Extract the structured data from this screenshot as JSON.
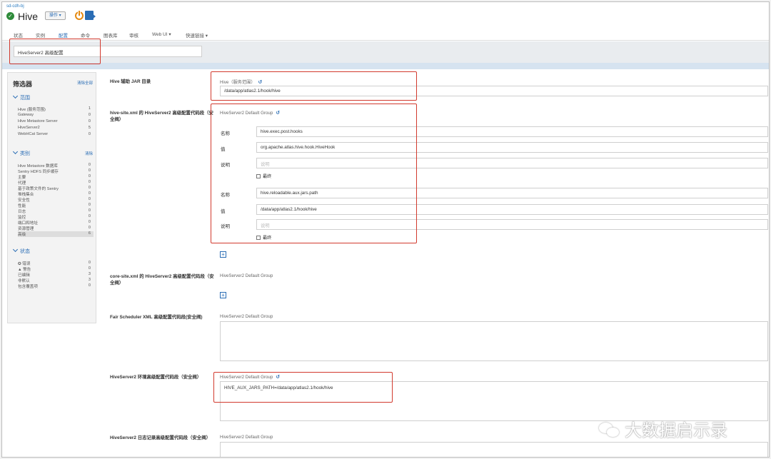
{
  "header": {
    "cluster": "sd-cdh-bj",
    "service_title": "Hive",
    "actions_label": "操作 ▾"
  },
  "tabs": [
    {
      "label": "状态"
    },
    {
      "label": "实例"
    },
    {
      "label": "配置"
    },
    {
      "label": "命令"
    },
    {
      "label": "图表库"
    },
    {
      "label": "审核"
    },
    {
      "label": "Web UI ▾"
    },
    {
      "label": "快速链接 ▾"
    }
  ],
  "active_tab": "配置",
  "search": {
    "value": "HiveServer2 高级配置"
  },
  "sidebar": {
    "title": "筛选器",
    "clear_all": "清除全部",
    "scope": {
      "heading": "范围",
      "items": [
        {
          "label": "Hive (服务范围)",
          "count": "1"
        },
        {
          "label": "Gateway",
          "count": "0"
        },
        {
          "label": "Hive Metastore Server",
          "count": "0"
        },
        {
          "label": "HiveServer2",
          "count": "5"
        },
        {
          "label": "WebHCat Server",
          "count": "0"
        }
      ]
    },
    "category": {
      "heading": "类别",
      "clear": "清除",
      "items": [
        {
          "label": "Hive Metastore 数据库",
          "count": "0"
        },
        {
          "label": "Sentry HDFS 同步缓存",
          "count": "0"
        },
        {
          "label": "主要",
          "count": "0"
        },
        {
          "label": "代理",
          "count": "0"
        },
        {
          "label": "基于政策文件的 Sentry",
          "count": "0"
        },
        {
          "label": "堆栈集合",
          "count": "0"
        },
        {
          "label": "安全性",
          "count": "0"
        },
        {
          "label": "性能",
          "count": "0"
        },
        {
          "label": "日志",
          "count": "0"
        },
        {
          "label": "监控",
          "count": "0"
        },
        {
          "label": "端口和地址",
          "count": "0"
        },
        {
          "label": "资源管理",
          "count": "0"
        },
        {
          "label": "高级",
          "count": "6"
        }
      ]
    },
    "status": {
      "heading": "状态",
      "items": [
        {
          "label": "✪ 错误",
          "count": "0"
        },
        {
          "label": "▲ 警告",
          "count": "0"
        },
        {
          "label": "已编辑",
          "count": "3"
        },
        {
          "label": "非默认",
          "count": "3"
        },
        {
          "label": "包含覆盖项",
          "count": "0"
        }
      ]
    }
  },
  "props": {
    "aux_jar": {
      "label": "Hive 辅助 JAR 目录",
      "group": "Hive（服务范围）",
      "value": "/data/app/atlas2.1/hook/hive"
    },
    "hive_site": {
      "label": "hive-site.xml 的 HiveServer2 高级配置代码段（安全阀）",
      "group": "HiveServer2 Default Group",
      "name_label": "名称",
      "value_label": "值",
      "desc_label": "说明",
      "desc_placeholder": "说明",
      "final_label": "最终",
      "entries": [
        {
          "name": "hive.exec.post.hooks",
          "value": "org.apache.atlas.hive.hook.HiveHook"
        },
        {
          "name": "hive.reloadable.aux.jars.path",
          "value": "/data/app/atlas2.1/hook/hive"
        }
      ]
    },
    "core_site": {
      "label": "core-site.xml 的 HiveServer2 高级配置代码段（安全阀）",
      "group": "HiveServer2 Default Group"
    },
    "fair": {
      "label": "Fair Scheduler XML 高级配置代码段(安全阀)",
      "group": "HiveServer2 Default Group"
    },
    "env": {
      "label": "HiveServer2 环境高级配置代码段（安全阀）",
      "group": "HiveServer2 Default Group",
      "value": "HIVE_AUX_JARS_PATH=/data/app/atlas2.1/hook/hive"
    },
    "log": {
      "label": "HiveServer2 日志记录高级配置代码段（安全阀）",
      "group": "HiveServer2 Default Group"
    }
  },
  "watermark": "大数据启示录",
  "colors": {
    "accent": "#2a6db5",
    "highlight": "#d23a2e",
    "success": "#2e8b3a",
    "power": "#e58a12"
  }
}
